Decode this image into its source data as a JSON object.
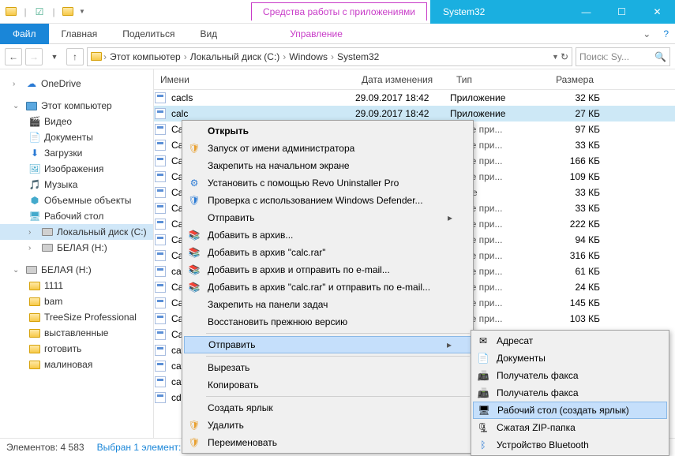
{
  "titlebar": {
    "apptools": "Средства работы с приложениями",
    "title": "System32"
  },
  "ribbon": {
    "file": "Файл",
    "home": "Главная",
    "share": "Поделиться",
    "view": "Вид",
    "manage": "Управление"
  },
  "breadcrumb": {
    "segs": [
      "Этот компьютер",
      "Локальный диск (C:)",
      "Windows",
      "System32"
    ]
  },
  "search": {
    "placeholder": "Поиск: Sy..."
  },
  "nav": {
    "onedrive": "OneDrive",
    "thispc": "Этот компьютер",
    "videos": "Видео",
    "documents": "Документы",
    "downloads": "Загрузки",
    "pictures": "Изображения",
    "music": "Музыка",
    "objects3d": "Объемные объекты",
    "desktop": "Рабочий стол",
    "localc": "Локальный диск (C:)",
    "belaya": "БЕЛАЯ (H:)",
    "belaya2": "БЕЛАЯ (H:)",
    "f1111": "1111",
    "fbam": "bam",
    "ftreesize": "TreeSize Professional",
    "fvyst": "выставленные",
    "fgot": "готовить",
    "fmal": "малиновая"
  },
  "columns": {
    "name": "Имени",
    "date": "Дата изменения",
    "type": "Тип",
    "size": "Размера"
  },
  "files": [
    {
      "name": "cacls",
      "date": "29.09.2017 18:42",
      "type": "Приложение",
      "size": "32 КБ"
    },
    {
      "name": "calc",
      "date": "29.09.2017 18:42",
      "type": "Приложение",
      "size": "27 КБ",
      "sel": true
    },
    {
      "name": "Cal",
      "type_partial": "нение при...",
      "size": "97 КБ"
    },
    {
      "name": "Cal",
      "type_partial": "нение при...",
      "size": "33 КБ"
    },
    {
      "name": "Cal",
      "type_partial": "нение при...",
      "size": "166 КБ"
    },
    {
      "name": "Car",
      "type_partial": "нение при...",
      "size": "109 КБ"
    },
    {
      "name": "Car",
      "type_partial": "жение",
      "size": "33 КБ"
    },
    {
      "name": "Car",
      "type_partial": "нение при...",
      "size": "33 КБ"
    },
    {
      "name": "Car",
      "type_partial": "нение при...",
      "size": "222 КБ"
    },
    {
      "name": "Cap",
      "type_partial": "нение при...",
      "size": "94 КБ"
    },
    {
      "name": "Cap",
      "type_partial": "нение при...",
      "size": "316 КБ"
    },
    {
      "name": "cap",
      "type_partial": "нение при...",
      "size": "61 КБ"
    },
    {
      "name": "Cas",
      "type_partial": "нение при...",
      "size": "24 КБ"
    },
    {
      "name": "Cas",
      "type_partial": "нение при...",
      "size": "145 КБ"
    },
    {
      "name": "Cas",
      "type_partial": "нение при...",
      "size": "103 КБ"
    },
    {
      "name": "Cas"
    },
    {
      "name": "cats"
    },
    {
      "name": "cats"
    },
    {
      "name": "cats"
    },
    {
      "name": "cdc"
    }
  ],
  "ctx": {
    "open": "Открыть",
    "runas": "Запуск от имени администратора",
    "pinstart": "Закрепить на начальном экране",
    "revo": "Установить с помощью Revo Uninstaller Pro",
    "defender": "Проверка с использованием Windows Defender...",
    "sendto": "Отправить",
    "addarch": "Добавить в архив...",
    "addrar": "Добавить в архив \"calc.rar\"",
    "addmail": "Добавить в архив и отправить по e-mail...",
    "addrarmail": "Добавить в архив \"calc.rar\" и отправить по e-mail...",
    "pintask": "Закрепить на панели задач",
    "restore": "Восстановить прежнюю версию",
    "sendto2": "Отправить",
    "cut": "Вырезать",
    "copy": "Копировать",
    "shortcut": "Создать ярлык",
    "delete": "Удалить",
    "rename": "Переименовать"
  },
  "submenu": {
    "addr": "Адресат",
    "docs": "Документы",
    "faxrecv": "Получатель факса",
    "faxrecv2": "Получатель факса",
    "desktop": "Рабочий стол (создать ярлык)",
    "zip": "Сжатая ZIP-папка",
    "bt": "Устройство Bluetooth"
  },
  "status": {
    "elements": "Элементов: 4 583",
    "selected": "Выбран 1 элемент: 26,0 КБ"
  }
}
